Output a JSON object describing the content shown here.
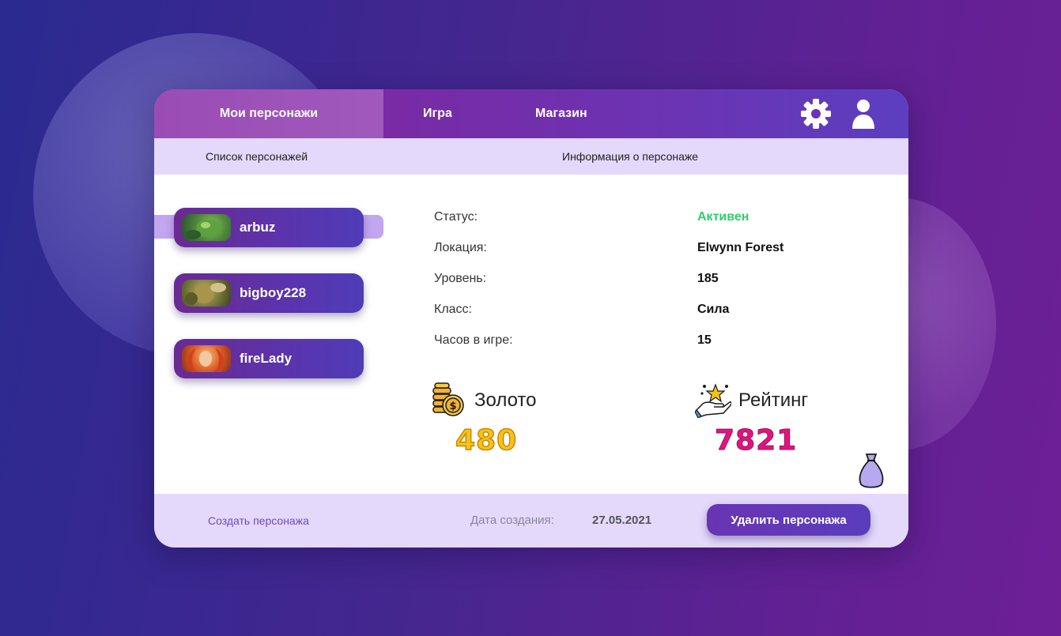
{
  "nav": {
    "tabs": [
      {
        "label": "Мои персонажи",
        "active": true
      },
      {
        "label": "Игра",
        "active": false
      },
      {
        "label": "Магазин",
        "active": false
      }
    ],
    "icons": [
      "gear-icon",
      "user-icon"
    ]
  },
  "subheader": {
    "list_title": "Список персонажей",
    "info_title": "Информация о персонаже"
  },
  "characters": [
    {
      "name": "arbuz",
      "selected": true,
      "avatar_colors": [
        "#3a6b3a",
        "#7fb04a"
      ]
    },
    {
      "name": "bigboy228",
      "selected": false,
      "avatar_colors": [
        "#4a5a2a",
        "#a89a4a"
      ]
    },
    {
      "name": "fireLady",
      "selected": false,
      "avatar_colors": [
        "#b0401a",
        "#f08a3a"
      ]
    }
  ],
  "info": {
    "rows": [
      {
        "label": "Статус:",
        "value": "Активен"
      },
      {
        "label": "Локация:",
        "value": "Elwynn Forest"
      },
      {
        "label": "Уровень:",
        "value": "185"
      },
      {
        "label": "Класс:",
        "value": "Сила"
      },
      {
        "label": "Часов в игре:",
        "value": "15"
      }
    ],
    "status_color": "#2fcf6a"
  },
  "stats": {
    "gold": {
      "label": "Золото",
      "value": "480",
      "icon": "gold-coins-icon",
      "color": "#f6c21a"
    },
    "rating": {
      "label": "Рейтинг",
      "value": "7821",
      "icon": "rating-hand-star-icon",
      "color": "#e0157e"
    }
  },
  "footer": {
    "create_label": "Создать персонажа",
    "date_label": "Дата создания:",
    "date_value": "27.05.2021",
    "delete_label": "Удалить персонажа"
  },
  "colors": {
    "accent": "#6a34b3",
    "panel_light": "#e4d8fb",
    "background_start": "#2a2a90",
    "background_end": "#6e1f96"
  }
}
